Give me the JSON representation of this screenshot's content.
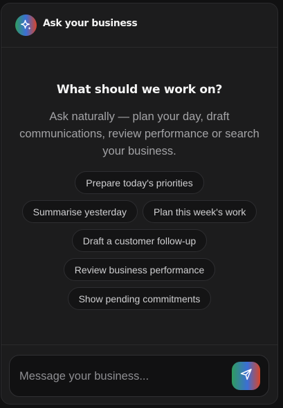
{
  "header": {
    "title": "Ask your business",
    "logo_icon": "sparkle-icon"
  },
  "hero": {
    "title": "What should we work on?",
    "subtitle": "Ask naturally — plan your day, draft communications, review performance or search your business."
  },
  "suggestions": [
    "Prepare today's priorities",
    "Summarise yesterday",
    "Plan this week's work",
    "Draft a customer follow-up",
    "Review business performance",
    "Show pending commitments"
  ],
  "composer": {
    "placeholder": "Message your business...",
    "value": "",
    "send_icon": "send-icon"
  },
  "colors": {
    "background": "#1c1c1d",
    "accent_green": "#2f9c5e",
    "accent_blue": "#3b6fd6",
    "accent_red": "#d8452a"
  }
}
